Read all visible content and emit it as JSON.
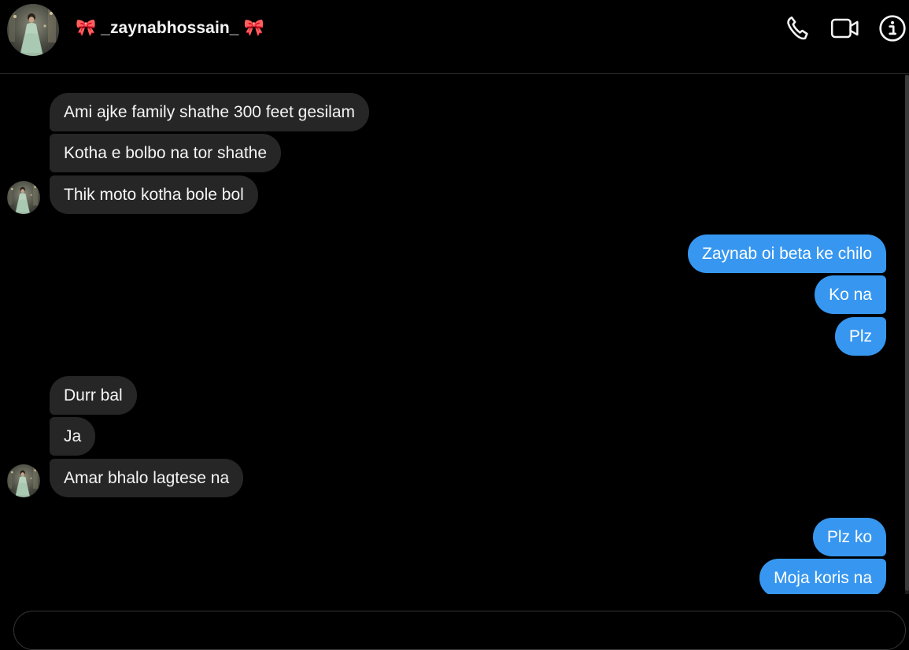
{
  "header": {
    "username": "🎀 _zaynabhossain_ 🎀",
    "icons": [
      "phone-icon",
      "video-camera-icon",
      "info-icon"
    ]
  },
  "messages": [
    {
      "side": "incoming",
      "text": "Ami ajke family shathe 300 feet gesilam"
    },
    {
      "side": "incoming",
      "text": "Kotha e bolbo na tor shathe"
    },
    {
      "side": "incoming",
      "text": "Thik moto kotha bole bol",
      "avatar": true
    },
    {
      "side": "outgoing",
      "text": "Zaynab oi beta ke chilo"
    },
    {
      "side": "outgoing",
      "text": "Ko na"
    },
    {
      "side": "outgoing",
      "text": "Plz"
    },
    {
      "side": "incoming",
      "text": "Durr bal"
    },
    {
      "side": "incoming",
      "text": "Ja"
    },
    {
      "side": "incoming",
      "text": "Amar bhalo lagtese na",
      "avatar": true
    },
    {
      "side": "outgoing",
      "text": "Plz ko"
    },
    {
      "side": "outgoing",
      "text": "Moja koris na"
    }
  ],
  "colors": {
    "background": "#000000",
    "incoming_bubble": "#262626",
    "outgoing_bubble": "#3797f0",
    "text": "#f5f5f5"
  }
}
